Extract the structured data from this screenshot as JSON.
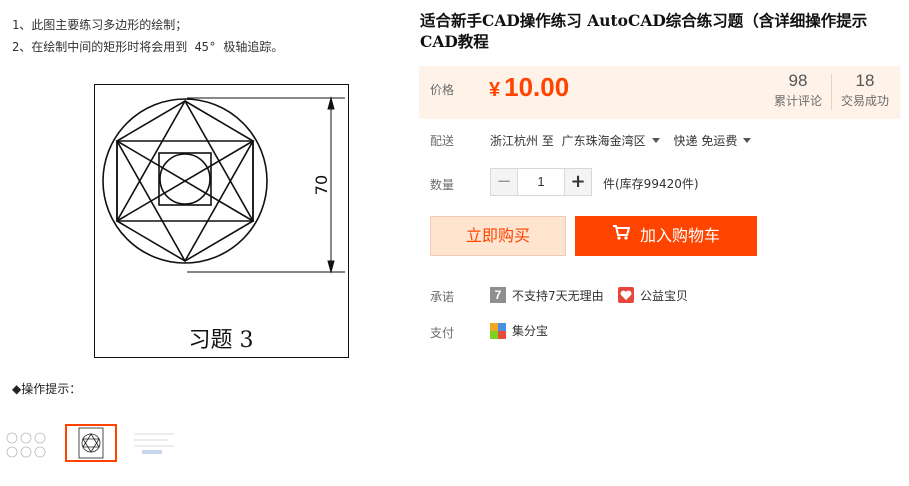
{
  "left": {
    "notes": [
      "1、此图主要练习多边形的绘制；",
      "2、在绘制中间的矩形时将会用到 45° 极轴追踪。"
    ],
    "drawing": {
      "dimension_value": "70",
      "caption": "习题  3"
    },
    "tip": "◆操作提示："
  },
  "product": {
    "title": "适合新手CAD操作练习 AutoCAD综合练习题（含详细操作提示CAD教程"
  },
  "price": {
    "label": "价格",
    "currency": "¥",
    "value": "10.00",
    "reviews_count": "98",
    "reviews_label": "累计评论",
    "sales_count": "18",
    "sales_label": "交易成功"
  },
  "shipping": {
    "label": "配送",
    "from": "浙江杭州 至",
    "to": "广东珠海金湾区",
    "method": "快递 免运费"
  },
  "quantity": {
    "label": "数量",
    "minus": "−",
    "value": "1",
    "plus": "+",
    "stock": "件(库存99420件)"
  },
  "actions": {
    "buy_now": "立即购买",
    "add_to_cart": "加入购物车"
  },
  "promise": {
    "label": "承诺",
    "badge": "7",
    "no_return": "不支持7天无理由",
    "charity": "公益宝贝"
  },
  "payment": {
    "label": "支付",
    "method": "集分宝"
  },
  "colors": {
    "accent": "#ff4400",
    "price_bg": "#fff2e8",
    "buy_bg": "#ffe4d0"
  }
}
